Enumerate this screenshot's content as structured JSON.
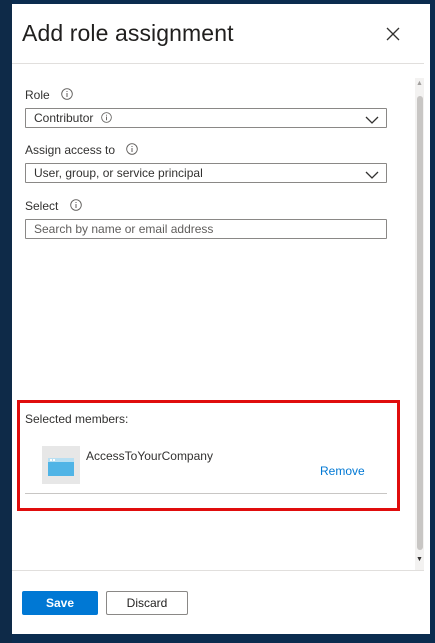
{
  "dialog": {
    "title": "Add role assignment",
    "close_icon": "close-icon"
  },
  "role": {
    "label": "Role",
    "value": "Contributor",
    "info_icon": "info-icon"
  },
  "assign_access": {
    "label": "Assign access to",
    "value": "User, group, or service principal"
  },
  "select": {
    "label": "Select",
    "placeholder": "Search by name or email address"
  },
  "selected_members": {
    "label": "Selected members:",
    "items": [
      {
        "name": "AccessToYourCompany",
        "action": "Remove",
        "icon": "app-registration-icon"
      }
    ]
  },
  "footer": {
    "save_label": "Save",
    "discard_label": "Discard"
  },
  "colors": {
    "primary": "#0078d4",
    "highlight": "#e00d0d",
    "backdrop": "#0b2c4f"
  }
}
